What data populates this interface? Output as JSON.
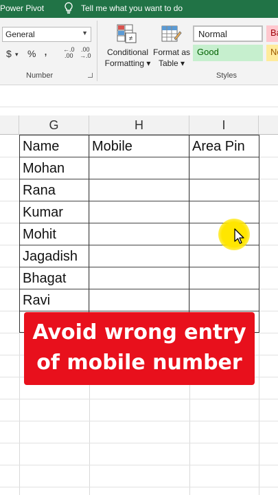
{
  "topbar": {
    "tab_label": "Power Pivot",
    "tell_me": "Tell me what you want to do",
    "background": "#217346"
  },
  "ribbon": {
    "number_group": {
      "format_value": "General",
      "currency_symbol": "$",
      "dropdown_caret": "▾",
      "percent_symbol": "%",
      "comma_symbol": "̧",
      "increase_decimal": "←.0\n.00",
      "decrease_decimal": ".00\n→.0",
      "label": "Number"
    },
    "conditional_formatting": {
      "line1": "Conditional",
      "line2": "Formatting ▾"
    },
    "format_as_table": {
      "line1": "Format as",
      "line2": "Table ▾"
    },
    "styles": [
      {
        "label": "Normal",
        "bg": "#ffffff",
        "color": "#222222"
      },
      {
        "label": "Ba",
        "bg": "#ffc7ce",
        "color": "#9c0006"
      },
      {
        "label": "Good",
        "bg": "#c6efce",
        "color": "#006100"
      },
      {
        "label": "Ne",
        "bg": "#ffeb9c",
        "color": "#9c5700"
      }
    ],
    "styles_label": "Styles"
  },
  "sheet": {
    "columns": [
      "G",
      "H",
      "I"
    ],
    "headers": [
      "Name",
      "Mobile",
      "Area Pin"
    ],
    "names": [
      "Mohan",
      "Rana",
      "Kumar",
      "Mohit",
      "Jagadish",
      "Bhagat",
      "Ravi"
    ]
  },
  "banner": {
    "line1": "Avoid wrong entry",
    "line2": "of mobile number",
    "color": "#e8101c"
  },
  "icons": {
    "bulb": "lightbulb-icon",
    "cursor": "mouse-pointer-icon"
  }
}
